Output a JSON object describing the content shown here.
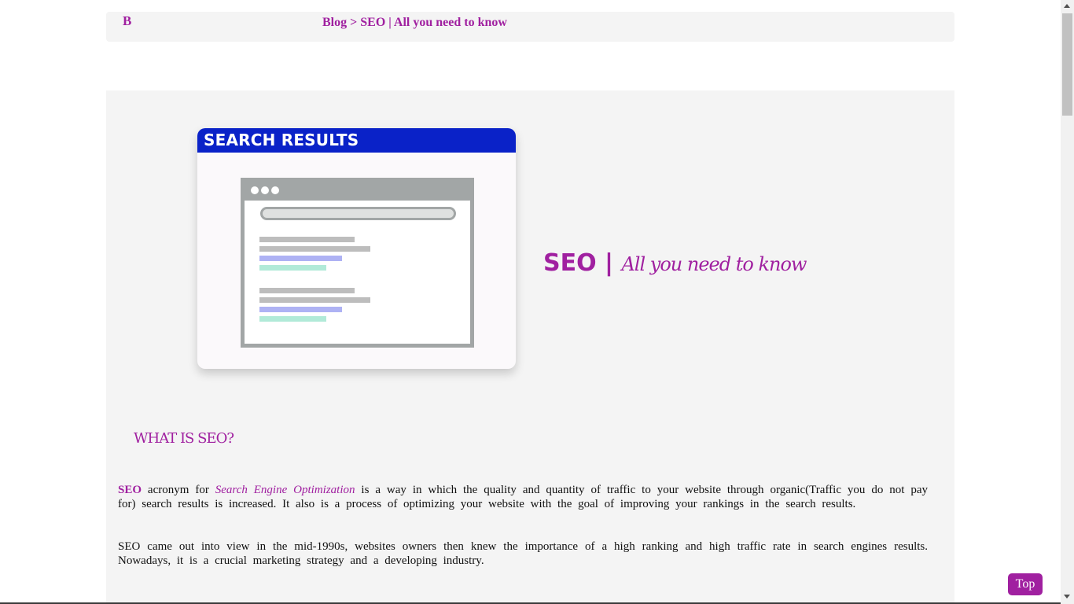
{
  "nav": {
    "logo": "B",
    "breadcrumb": {
      "blog": "Blog",
      "sep": " > ",
      "current": "SEO | All you need to know"
    }
  },
  "hero": {
    "card_title": "SEARCH RESULTS",
    "title_main": "SEO | ",
    "title_sub": "All you need to know"
  },
  "section": {
    "heading": "WHAT IS SEO?",
    "p1": {
      "term": "SEO",
      "pre": " acronym for ",
      "expansion": "Search Engine Optimization",
      "rest": " is a way in which the quality and quantity of traffic to your website through organic(Traffic you do not pay for) search results is increased. It also is a process of optimizing your website with the goal of improving your rankings in the search results."
    },
    "p2": "SEO came out into view in the mid-1990s, websites owners then knew the importance of a high ranking and high traffic rate in search engines results. Nowadays, it is a crucial marketing strategy and a developing industry."
  },
  "top_button": "Top",
  "colors": {
    "accent": "#a020a0",
    "card_header": "#0a22c8",
    "panel": "#f4f4f4"
  }
}
